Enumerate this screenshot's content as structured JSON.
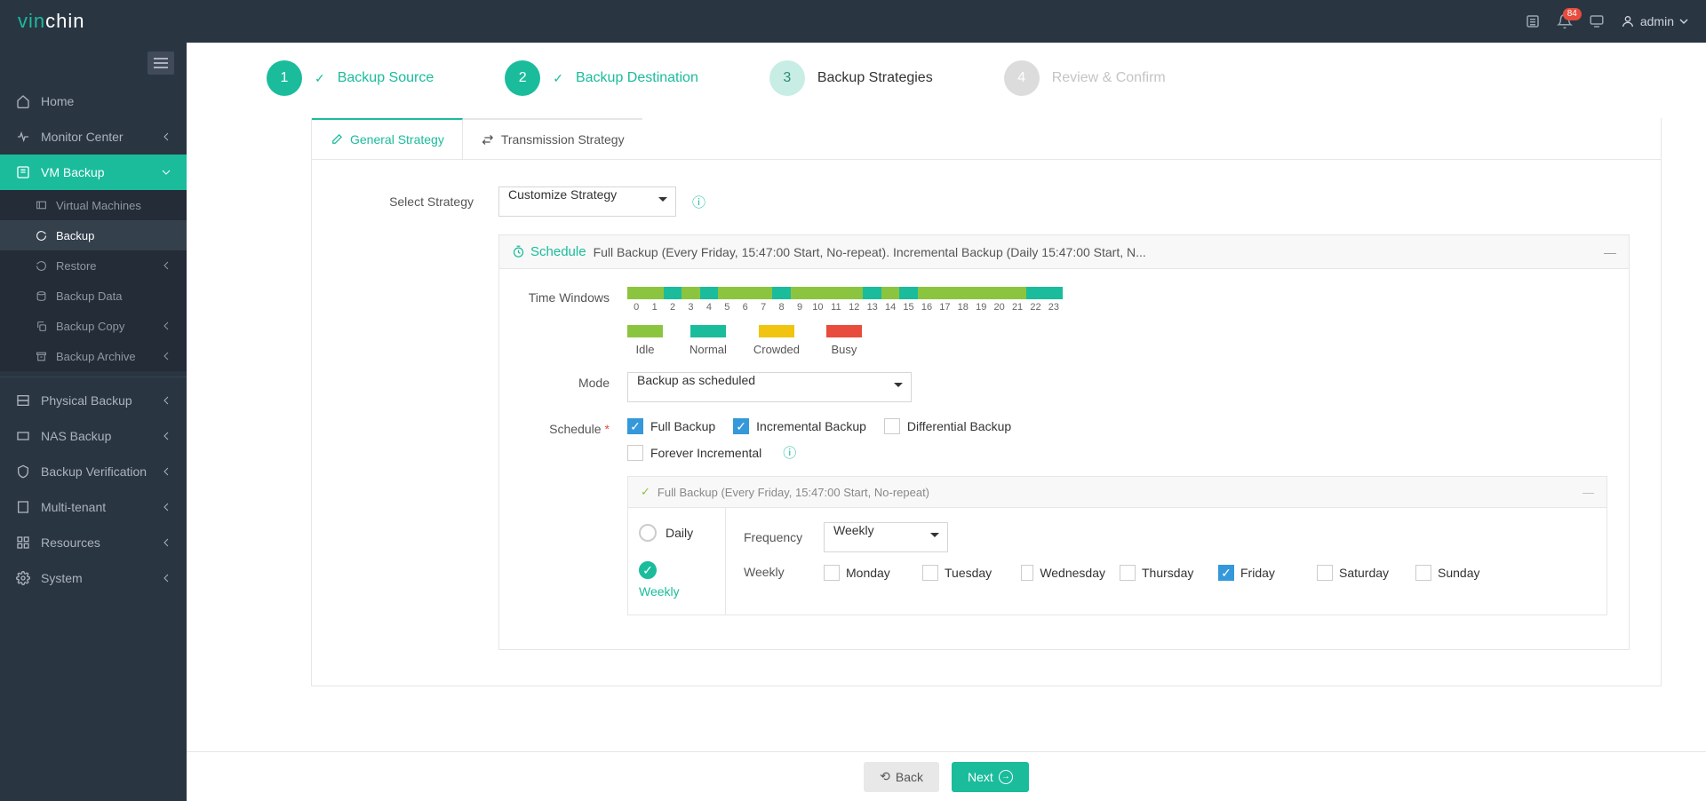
{
  "header": {
    "logo_prefix": "vin",
    "logo_suffix": "chin",
    "notification_count": "84",
    "user": "admin"
  },
  "sidebar": {
    "items": [
      {
        "label": "Home"
      },
      {
        "label": "Monitor Center"
      },
      {
        "label": "VM Backup"
      },
      {
        "label": "Physical Backup"
      },
      {
        "label": "NAS Backup"
      },
      {
        "label": "Backup Verification"
      },
      {
        "label": "Multi-tenant"
      },
      {
        "label": "Resources"
      },
      {
        "label": "System"
      }
    ],
    "vm_sub": [
      "Virtual Machines",
      "Backup",
      "Restore",
      "Backup Data",
      "Backup Copy",
      "Backup Archive"
    ]
  },
  "steps": [
    "Backup Source",
    "Backup Destination",
    "Backup Strategies",
    "Review & Confirm"
  ],
  "tabs": [
    "General Strategy",
    "Transmission Strategy"
  ],
  "form": {
    "select_strategy_label": "Select Strategy",
    "select_strategy_value": "Customize Strategy"
  },
  "schedule_panel": {
    "title": "Schedule",
    "desc": "Full Backup (Every Friday, 15:47:00 Start, No-repeat). Incremental Backup (Daily 15:47:00 Start, N...",
    "time_windows_label": "Time Windows",
    "hours": [
      "0",
      "1",
      "2",
      "3",
      "4",
      "5",
      "6",
      "7",
      "8",
      "9",
      "10",
      "11",
      "12",
      "13",
      "14",
      "15",
      "16",
      "17",
      "18",
      "19",
      "20",
      "21",
      "22",
      "23"
    ],
    "timewindow_status": [
      "idle",
      "idle",
      "normal",
      "idle",
      "normal",
      "idle",
      "idle",
      "idle",
      "normal",
      "idle",
      "idle",
      "idle",
      "idle",
      "normal",
      "idle",
      "normal",
      "idle",
      "idle",
      "idle",
      "idle",
      "idle",
      "idle",
      "normal",
      "normal"
    ],
    "legend": [
      "Idle",
      "Normal",
      "Crowded",
      "Busy"
    ],
    "mode_label": "Mode",
    "mode_value": "Backup as scheduled",
    "schedule_label": "Schedule",
    "checks": [
      "Full Backup",
      "Incremental Backup",
      "Differential Backup",
      "Forever Incremental"
    ],
    "full_backup_header": "Full Backup (Every Friday, 15:47:00 Start, No-repeat)",
    "radio_daily": "Daily",
    "radio_weekly": "Weekly",
    "frequency_label": "Frequency",
    "frequency_value": "Weekly",
    "weekly_label": "Weekly",
    "days": [
      "Monday",
      "Tuesday",
      "Wednesday",
      "Thursday",
      "Friday",
      "Saturday",
      "Sunday"
    ]
  },
  "footer": {
    "back": "Back",
    "next": "Next"
  },
  "chart_data": {
    "type": "bar",
    "title": "Time Windows",
    "categories": [
      0,
      1,
      2,
      3,
      4,
      5,
      6,
      7,
      8,
      9,
      10,
      11,
      12,
      13,
      14,
      15,
      16,
      17,
      18,
      19,
      20,
      21,
      22,
      23
    ],
    "values": [
      "idle",
      "idle",
      "normal",
      "idle",
      "normal",
      "idle",
      "idle",
      "idle",
      "normal",
      "idle",
      "idle",
      "idle",
      "idle",
      "normal",
      "idle",
      "normal",
      "idle",
      "idle",
      "idle",
      "idle",
      "idle",
      "idle",
      "normal",
      "normal"
    ],
    "legend": [
      "Idle",
      "Normal",
      "Crowded",
      "Busy"
    ]
  }
}
